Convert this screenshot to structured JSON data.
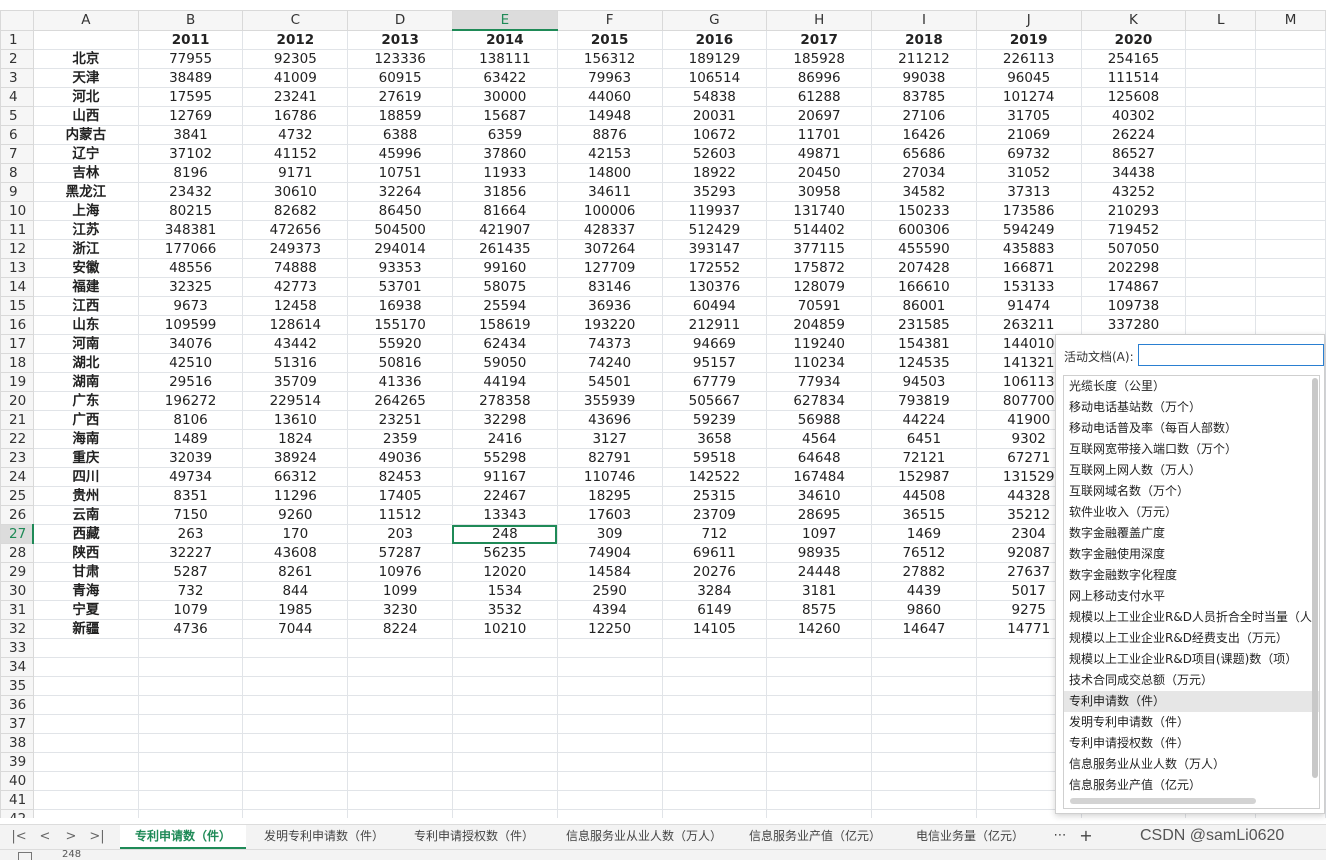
{
  "columns": [
    "A",
    "B",
    "C",
    "D",
    "E",
    "F",
    "G",
    "H",
    "I",
    "J",
    "K",
    "L",
    "M"
  ],
  "header_row": [
    "",
    "2011",
    "2012",
    "2013",
    "2014",
    "2015",
    "2016",
    "2017",
    "2018",
    "2019",
    "2020"
  ],
  "rows": [
    [
      "北京",
      "77955",
      "92305",
      "123336",
      "138111",
      "156312",
      "189129",
      "185928",
      "211212",
      "226113",
      "254165"
    ],
    [
      "天津",
      "38489",
      "41009",
      "60915",
      "63422",
      "79963",
      "106514",
      "86996",
      "99038",
      "96045",
      "111514"
    ],
    [
      "河北",
      "17595",
      "23241",
      "27619",
      "30000",
      "44060",
      "54838",
      "61288",
      "83785",
      "101274",
      "125608"
    ],
    [
      "山西",
      "12769",
      "16786",
      "18859",
      "15687",
      "14948",
      "20031",
      "20697",
      "27106",
      "31705",
      "40302"
    ],
    [
      "内蒙古",
      "3841",
      "4732",
      "6388",
      "6359",
      "8876",
      "10672",
      "11701",
      "16426",
      "21069",
      "26224"
    ],
    [
      "辽宁",
      "37102",
      "41152",
      "45996",
      "37860",
      "42153",
      "52603",
      "49871",
      "65686",
      "69732",
      "86527"
    ],
    [
      "吉林",
      "8196",
      "9171",
      "10751",
      "11933",
      "14800",
      "18922",
      "20450",
      "27034",
      "31052",
      "34438"
    ],
    [
      "黑龙江",
      "23432",
      "30610",
      "32264",
      "31856",
      "34611",
      "35293",
      "30958",
      "34582",
      "37313",
      "43252"
    ],
    [
      "上海",
      "80215",
      "82682",
      "86450",
      "81664",
      "100006",
      "119937",
      "131740",
      "150233",
      "173586",
      "210293"
    ],
    [
      "江苏",
      "348381",
      "472656",
      "504500",
      "421907",
      "428337",
      "512429",
      "514402",
      "600306",
      "594249",
      "719452"
    ],
    [
      "浙江",
      "177066",
      "249373",
      "294014",
      "261435",
      "307264",
      "393147",
      "377115",
      "455590",
      "435883",
      "507050"
    ],
    [
      "安徽",
      "48556",
      "74888",
      "93353",
      "99160",
      "127709",
      "172552",
      "175872",
      "207428",
      "166871",
      "202298"
    ],
    [
      "福建",
      "32325",
      "42773",
      "53701",
      "58075",
      "83146",
      "130376",
      "128079",
      "166610",
      "153133",
      "174867"
    ],
    [
      "江西",
      "9673",
      "12458",
      "16938",
      "25594",
      "36936",
      "60494",
      "70591",
      "86001",
      "91474",
      "109738"
    ],
    [
      "山东",
      "109599",
      "128614",
      "155170",
      "158619",
      "193220",
      "212911",
      "204859",
      "231585",
      "263211",
      "337280"
    ],
    [
      "河南",
      "34076",
      "43442",
      "55920",
      "62434",
      "74373",
      "94669",
      "119240",
      "154381",
      "144010",
      ""
    ],
    [
      "湖北",
      "42510",
      "51316",
      "50816",
      "59050",
      "74240",
      "95157",
      "110234",
      "124535",
      "141321",
      ""
    ],
    [
      "湖南",
      "29516",
      "35709",
      "41336",
      "44194",
      "54501",
      "67779",
      "77934",
      "94503",
      "106113",
      ""
    ],
    [
      "广东",
      "196272",
      "229514",
      "264265",
      "278358",
      "355939",
      "505667",
      "627834",
      "793819",
      "807700",
      ""
    ],
    [
      "广西",
      "8106",
      "13610",
      "23251",
      "32298",
      "43696",
      "59239",
      "56988",
      "44224",
      "41900",
      ""
    ],
    [
      "海南",
      "1489",
      "1824",
      "2359",
      "2416",
      "3127",
      "3658",
      "4564",
      "6451",
      "9302",
      ""
    ],
    [
      "重庆",
      "32039",
      "38924",
      "49036",
      "55298",
      "82791",
      "59518",
      "64648",
      "72121",
      "67271",
      ""
    ],
    [
      "四川",
      "49734",
      "66312",
      "82453",
      "91167",
      "110746",
      "142522",
      "167484",
      "152987",
      "131529",
      ""
    ],
    [
      "贵州",
      "8351",
      "11296",
      "17405",
      "22467",
      "18295",
      "25315",
      "34610",
      "44508",
      "44328",
      ""
    ],
    [
      "云南",
      "7150",
      "9260",
      "11512",
      "13343",
      "17603",
      "23709",
      "28695",
      "36515",
      "35212",
      ""
    ],
    [
      "西藏",
      "263",
      "170",
      "203",
      "248",
      "309",
      "712",
      "1097",
      "1469",
      "2304",
      ""
    ],
    [
      "陕西",
      "32227",
      "43608",
      "57287",
      "56235",
      "74904",
      "69611",
      "98935",
      "76512",
      "92087",
      ""
    ],
    [
      "甘肃",
      "5287",
      "8261",
      "10976",
      "12020",
      "14584",
      "20276",
      "24448",
      "27882",
      "27637",
      ""
    ],
    [
      "青海",
      "732",
      "844",
      "1099",
      "1534",
      "2590",
      "3284",
      "3181",
      "4439",
      "5017",
      ""
    ],
    [
      "宁夏",
      "1079",
      "1985",
      "3230",
      "3532",
      "4394",
      "6149",
      "8575",
      "9860",
      "9275",
      ""
    ],
    [
      "新疆",
      "4736",
      "7044",
      "8224",
      "10210",
      "12250",
      "14105",
      "14260",
      "14647",
      "14771",
      ""
    ]
  ],
  "empty_row_numbers": [
    "33",
    "34",
    "35",
    "36",
    "37",
    "38",
    "39",
    "40",
    "41",
    "42"
  ],
  "popup": {
    "label": "活动文档(A):",
    "input_value": "",
    "items": [
      "光缆长度（公里）",
      "移动电话基站数（万个）",
      "移动电话普及率（每百人部数）",
      "互联网宽带接入端口数（万个）",
      "互联网上网人数（万人）",
      "互联网域名数（万个）",
      "软件业收入（万元）",
      "数字金融覆盖广度",
      "数字金融使用深度",
      "数字金融数字化程度",
      "网上移动支付水平",
      "规模以上工业企业R&D人员折合全时当量（人",
      "规模以上工业企业R&D经费支出（万元）",
      "规模以上工业企业R&D项目(课题)数（项）",
      "技术合同成交总额（万元）",
      "专利申请数（件）",
      "发明专利申请数（件）",
      "专利申请授权数（件）",
      "信息服务业从业人数（万人）",
      "信息服务业产值（亿元）"
    ],
    "highlighted_index": 15
  },
  "tabs": [
    "专利申请数（件）",
    "发明专利申请数（件）",
    "专利申请授权数（件）",
    "信息服务业从业人数（万人）",
    "信息服务业产值（亿元）",
    "电信业务量（亿元）"
  ],
  "nav_icons": [
    "first-sheet-icon",
    "prev-sheet-icon",
    "next-sheet-icon",
    "last-sheet-icon"
  ],
  "more_tabs_glyph": "⋯",
  "add_tab_glyph": "+",
  "watermark": "CSDN @samLi0620",
  "status_text": "248",
  "active_cell": {
    "col": "E",
    "row": 27,
    "value": "248"
  },
  "accent_color": "#1f8a57"
}
